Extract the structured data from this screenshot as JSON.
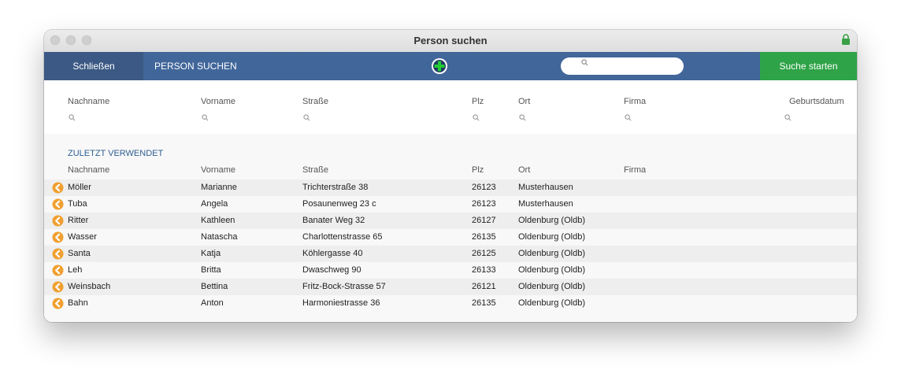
{
  "window": {
    "title": "Person suchen"
  },
  "toolbar": {
    "close_label": "Schließen",
    "section_title": "PERSON SUCHEN",
    "search": {
      "value": "",
      "placeholder": ""
    },
    "start_label": "Suche starten"
  },
  "filter_columns": [
    "Nachname",
    "Vorname",
    "Straße",
    "Plz",
    "Ort",
    "Firma",
    "Geburtsdatum"
  ],
  "recent": {
    "label": "ZULETZT VERWENDET",
    "columns": [
      "Nachname",
      "Vorname",
      "Straße",
      "Plz",
      "Ort",
      "Firma"
    ],
    "rows": [
      {
        "nachname": "Möller",
        "vorname": "Marianne",
        "strasse": "Trichterstraße 38",
        "plz": "26123",
        "ort": "Musterhausen",
        "firma": ""
      },
      {
        "nachname": "Tuba",
        "vorname": "Angela",
        "strasse": "Posaunenweg 23 c",
        "plz": "26123",
        "ort": "Musterhausen",
        "firma": ""
      },
      {
        "nachname": "Ritter",
        "vorname": "Kathleen",
        "strasse": "Banater Weg 32",
        "plz": "26127",
        "ort": "Oldenburg (Oldb)",
        "firma": ""
      },
      {
        "nachname": "Wasser",
        "vorname": "Natascha",
        "strasse": "Charlottenstrasse 65",
        "plz": "26135",
        "ort": "Oldenburg (Oldb)",
        "firma": ""
      },
      {
        "nachname": "Santa",
        "vorname": "Katja",
        "strasse": "Köhlergasse 40",
        "plz": "26125",
        "ort": "Oldenburg (Oldb)",
        "firma": ""
      },
      {
        "nachname": "Leh",
        "vorname": "Britta",
        "strasse": "Dwaschweg 90",
        "plz": "26133",
        "ort": "Oldenburg (Oldb)",
        "firma": ""
      },
      {
        "nachname": "Weinsbach",
        "vorname": "Bettina",
        "strasse": "Fritz-Bock-Strasse 57",
        "plz": "26121",
        "ort": "Oldenburg (Oldb)",
        "firma": ""
      },
      {
        "nachname": "Bahn",
        "vorname": "Anton",
        "strasse": "Harmoniestrasse 36",
        "plz": "26135",
        "ort": "Oldenburg (Oldb)",
        "firma": ""
      }
    ]
  },
  "colors": {
    "toolbar": "#41669a",
    "start_button": "#2ea347",
    "arrow": "#f0a030",
    "add": "#22cc33",
    "accent_text": "#2f5f93"
  },
  "icons": {
    "add": "plus-circle-icon",
    "row": "arrow-left-circle-icon",
    "search": "search-icon",
    "lock": "lock-icon"
  }
}
